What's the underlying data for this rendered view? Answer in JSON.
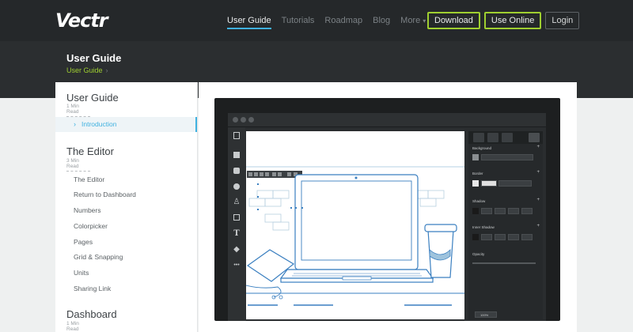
{
  "brand": {
    "logo": "Vectr"
  },
  "nav": {
    "links": [
      {
        "label": "User Guide",
        "active": true
      },
      {
        "label": "Tutorials",
        "active": false
      },
      {
        "label": "Roadmap",
        "active": false
      },
      {
        "label": "Blog",
        "active": false
      },
      {
        "label": "More",
        "active": false
      }
    ],
    "download": "Download",
    "use_online": "Use Online",
    "login": "Login"
  },
  "header": {
    "title": "User Guide",
    "breadcrumb": "User Guide",
    "breadcrumb_sep": "›"
  },
  "sidebar": {
    "sections": [
      {
        "title": "User Guide",
        "read": "1 Min Read",
        "items": [
          "Introduction"
        ],
        "active_item": "Introduction"
      },
      {
        "title": "The Editor",
        "read": "3 Min Read",
        "items": [
          "The Editor",
          "Return to Dashboard",
          "Numbers",
          "Colorpicker",
          "Pages",
          "Grid & Snapping",
          "Units",
          "Sharing Link"
        ]
      },
      {
        "title": "Dashboard",
        "read": "1 Min Read",
        "items": []
      }
    ]
  },
  "screenshot": {
    "panel_labels": [
      "Background",
      "Border",
      "Shadow",
      "Inner Shadow",
      "Opacity"
    ],
    "zoom": "100%"
  },
  "colors": {
    "accent": "#3fb1e0",
    "brand_green": "#9fcf30",
    "topbar": "#25282a"
  }
}
